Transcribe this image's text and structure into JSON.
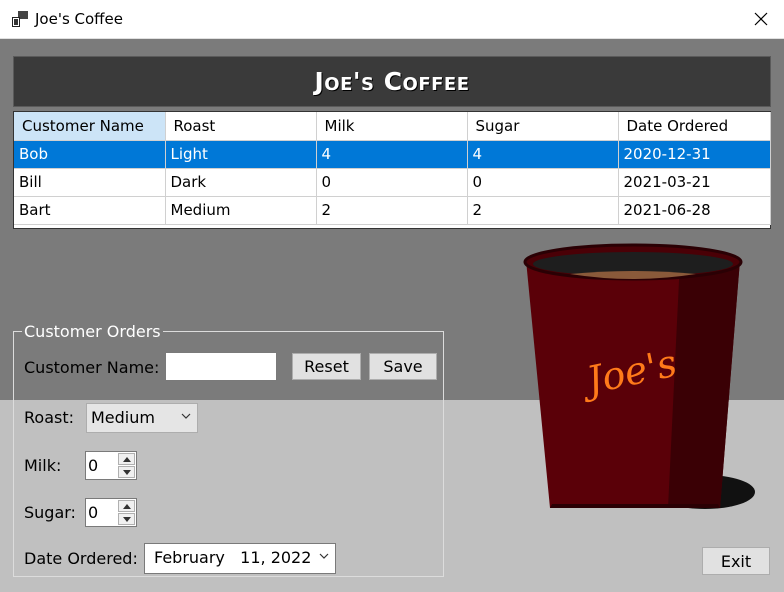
{
  "window": {
    "title": "Joe's Coffee"
  },
  "banner": {
    "title": "Joe's Coffee"
  },
  "grid": {
    "columns": [
      "Customer Name",
      "Roast",
      "Milk",
      "Sugar",
      "Date Ordered"
    ],
    "rows": [
      [
        "Bob",
        "Light",
        "4",
        "4",
        "2020-12-31"
      ],
      [
        "Bill",
        "Dark",
        "0",
        "0",
        "2021-03-21"
      ],
      [
        "Bart",
        "Medium",
        "2",
        "2",
        "2021-06-28"
      ]
    ],
    "selected_row": 0
  },
  "orders": {
    "group_title": "Customer Orders",
    "customer_name_label": "Customer Name:",
    "customer_name_value": "",
    "reset_label": "Reset",
    "save_label": "Save",
    "roast_label": "Roast:",
    "roast_value": "Medium",
    "milk_label": "Milk:",
    "milk_value": "0",
    "sugar_label": "Sugar:",
    "sugar_value": "0",
    "date_label": "Date Ordered:",
    "date_value": "February   11, 2022"
  },
  "footer": {
    "exit_label": "Exit"
  },
  "cup": {
    "text": "Joe's"
  },
  "colors": {
    "selection": "#0078d7",
    "cup": "#5a0008",
    "cup_text": "#ff7a1a"
  }
}
